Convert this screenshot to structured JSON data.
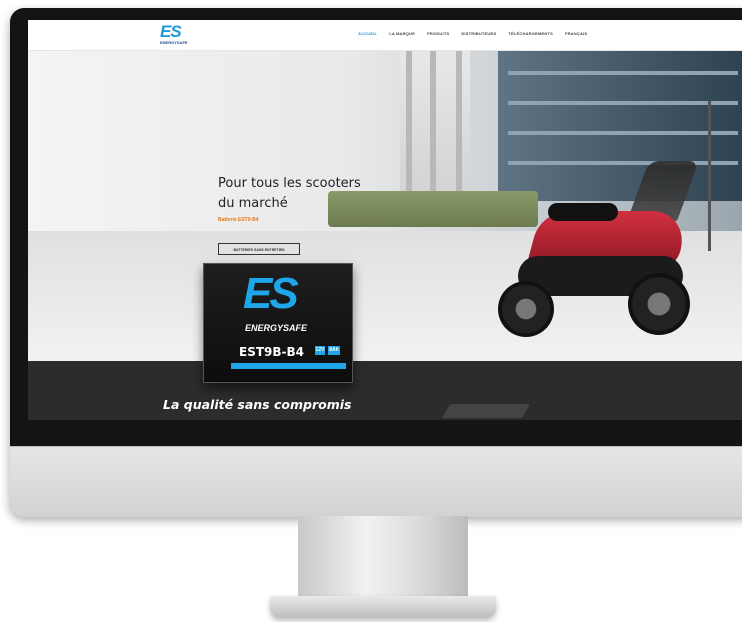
{
  "site": {
    "logo_text": "ES",
    "logo_brand": "ENERGYSAFE"
  },
  "nav": {
    "items": [
      "ACCUEIL",
      "LA MARQUE",
      "PRODUITS",
      "DISTRIBUTEURS",
      "TÉLÉCHARGEMENTS",
      "FRANÇAIS"
    ]
  },
  "hero": {
    "title": "Pour tous les scooters du marché",
    "subtitle": "Batterie EST9-B4",
    "button_label": "BATTERIES SANS ENTRETIEN"
  },
  "battery": {
    "es": "ES",
    "brand": "ENERGYSAFE",
    "model": "EST9B-B4",
    "voltage": "12V",
    "capacity": "8Ah"
  },
  "band": {
    "tagline": "La qualité sans compromis"
  },
  "colors": {
    "accent": "#1a9ad6",
    "orange": "#e07a1a",
    "dark_band": "#2c2c2c",
    "scooter_red": "#d23040"
  }
}
